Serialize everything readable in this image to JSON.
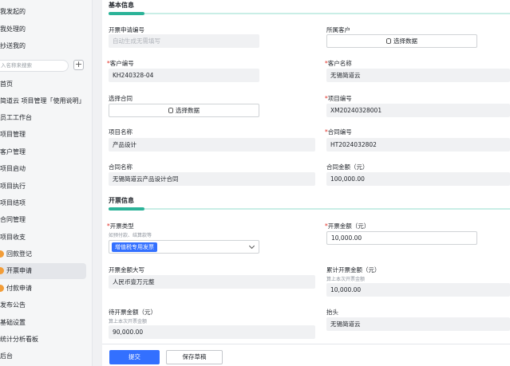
{
  "sidebar": {
    "top_items": [
      "我发起的",
      "我处理的",
      "抄送我的"
    ],
    "search_placeholder": "入名称来搜索",
    "plus": "+",
    "nav": [
      "首页",
      "简道云 项目管理「使用说明」",
      "员工工作台",
      "项目管理",
      "客户管理",
      "项目启动",
      "项目执行",
      "项目结项",
      "合同管理",
      "项目收支"
    ],
    "sub_items": [
      "回款登记",
      "开票申请",
      "付款申请"
    ],
    "nav_bottom": [
      "发布公告",
      "基础设置",
      "统计分析看板",
      "后台"
    ]
  },
  "basic": {
    "section_title": "基本信息",
    "invoice_no_label": "开票申请编号",
    "invoice_no_placeholder": "自动生成无需填写",
    "customer_label": "所属客户",
    "select_data": "选择数据",
    "customer_no_label": "客户编号",
    "customer_no": "KH240328-04",
    "customer_name_label": "客户名称",
    "customer_name": "无锡简道云",
    "contract_select_label": "选择合同",
    "project_no_label": "项目编号",
    "project_no": "XM20240328001",
    "project_name_label": "项目名称",
    "project_name": "产品设计",
    "contract_no_label": "合同编号",
    "contract_no": "HT2024032802",
    "contract_name_label": "合同名称",
    "contract_name": "无锡简道云产品设计合同",
    "contract_amount_label": "合同金额（元）",
    "contract_amount": "100,000.00"
  },
  "invoice": {
    "section_title": "开票信息",
    "type_label": "开票类型",
    "type_hint": "如预付款、结算款等",
    "type_value": "增值税专用发票",
    "amount_label": "开票金额（元）",
    "amount": "10,000.00",
    "amount_upper_label": "开票金额大写",
    "amount_upper": "人民币壹万元整",
    "cumulative_label": "累计开票金额（元）",
    "cumulative_hint": "算上本次开票金额",
    "cumulative": "10,000.00",
    "pending_label": "待开票金额（元）",
    "pending_hint": "算上本次开票金额",
    "pending": "90,000.00",
    "header_label": "抬头",
    "header": "无锡简道云"
  },
  "footer": {
    "submit": "提交",
    "save_draft": "保存草稿"
  },
  "colors": {
    "primary": "#3370ff",
    "accent_green": "#2bb398",
    "required": "#e02e24"
  }
}
